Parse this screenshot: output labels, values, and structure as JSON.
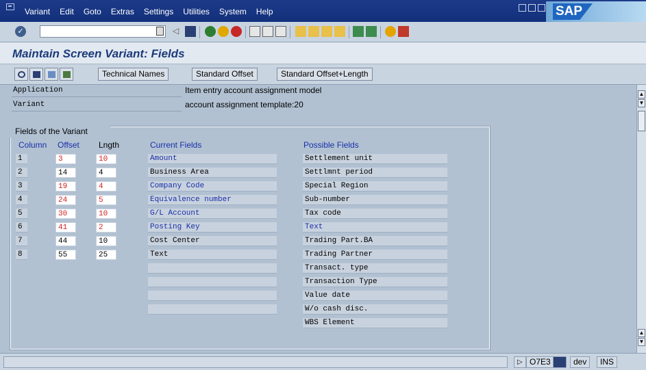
{
  "menu": [
    "Variant",
    "Edit",
    "Goto",
    "Extras",
    "Settings",
    "Utilities",
    "System",
    "Help"
  ],
  "brand": "SAP",
  "title": "Maintain Screen Variant: Fields",
  "app_toolbar": {
    "technical_names": "Technical Names",
    "standard_offset": "Standard Offset",
    "standard_offset_length": "Standard Offset+Length"
  },
  "header": {
    "application_label": "Application",
    "application_value": "Item entry account assignment model",
    "variant_label": "Variant",
    "variant_value": "account assignment template:20"
  },
  "group_title": "Fields of the Variant",
  "columns": {
    "column": "Column",
    "offset": "Offset",
    "length": "Lngth",
    "current": "Current Fields",
    "possible": "Possible Fields"
  },
  "rows": [
    {
      "col": "1",
      "offset": "3",
      "length": "10",
      "field": "Amount"
    },
    {
      "col": "2",
      "offset": "14",
      "length": "4",
      "field": "Business Area"
    },
    {
      "col": "3",
      "offset": "19",
      "length": "4",
      "field": "Company Code"
    },
    {
      "col": "4",
      "offset": "24",
      "length": "5",
      "field": "Equivalence number"
    },
    {
      "col": "5",
      "offset": "30",
      "length": "10",
      "field": "G/L Account"
    },
    {
      "col": "6",
      "offset": "41",
      "length": "2",
      "field": "Posting Key"
    },
    {
      "col": "7",
      "offset": "44",
      "length": "10",
      "field": "Cost Center"
    },
    {
      "col": "8",
      "offset": "55",
      "length": "25",
      "field": "Text"
    }
  ],
  "empty_current_rows": 4,
  "possible_fields": [
    "Settlement unit",
    "Settlmnt period",
    "Special Region",
    "Sub-number",
    "Tax code",
    "Text",
    "Trading Part.BA",
    "Trading Partner",
    "Transact. type",
    "Transaction Type",
    "Value date",
    "W/o cash disc.",
    "WBS Element"
  ],
  "status": {
    "system": "O7E3",
    "client": "dev",
    "mode": "INS"
  },
  "colors": {
    "required": "#d31d1d",
    "highlight": "#1a2fa8",
    "title": "#1c3a7a"
  }
}
